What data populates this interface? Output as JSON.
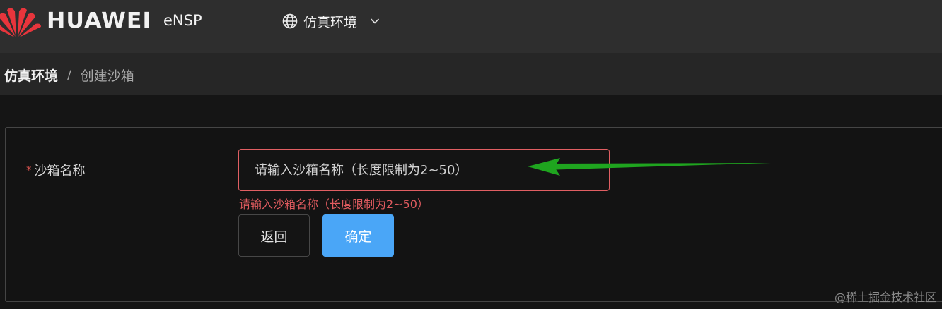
{
  "header": {
    "brand": "HUAWEI",
    "app_name": "eNSP",
    "env_label": "仿真环境"
  },
  "breadcrumb": {
    "root": "仿真环境",
    "separator": "/",
    "current": "创建沙箱"
  },
  "form": {
    "required_mark": "*",
    "label": "沙箱名称",
    "placeholder": "请输入沙箱名称（长度限制为2~50）",
    "value": "",
    "error": "请输入沙箱名称（长度限制为2~50）",
    "back_label": "返回",
    "confirm_label": "确定"
  },
  "watermark": "@稀土掘金技术社区",
  "colors": {
    "accent": "#4aa6f7",
    "error": "#e05b5f",
    "logo_red": "#e8353c",
    "arrow_green": "#1fa51f"
  }
}
